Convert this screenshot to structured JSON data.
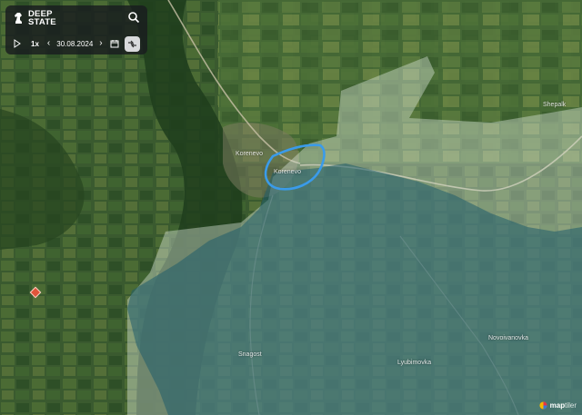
{
  "app": {
    "logo_line1": "DEEP",
    "logo_line2": "STATE"
  },
  "controls": {
    "speed": "1x",
    "prev": "‹",
    "date": "30.08.2024",
    "next": "›",
    "icons": [
      "play-icon",
      "calendar-icon",
      "swap-layers-icon",
      "search-icon"
    ]
  },
  "places": {
    "korenevo_north": "Korenevo",
    "korenevo_center": "Korenevo",
    "shepalkovka": "Shepalk",
    "snagost": "Snagost",
    "lyubimovka": "Lyubimovka",
    "novoivanovka": "Novoivanovka"
  },
  "attribution": {
    "brand_a": "map",
    "brand_b": "tiler"
  },
  "colors": {
    "occupied_zone": "#1f5d6b",
    "contested_zone": "#dce8dc",
    "highlight": "#3a9bea",
    "satellite_base": "#2f4a2a"
  }
}
